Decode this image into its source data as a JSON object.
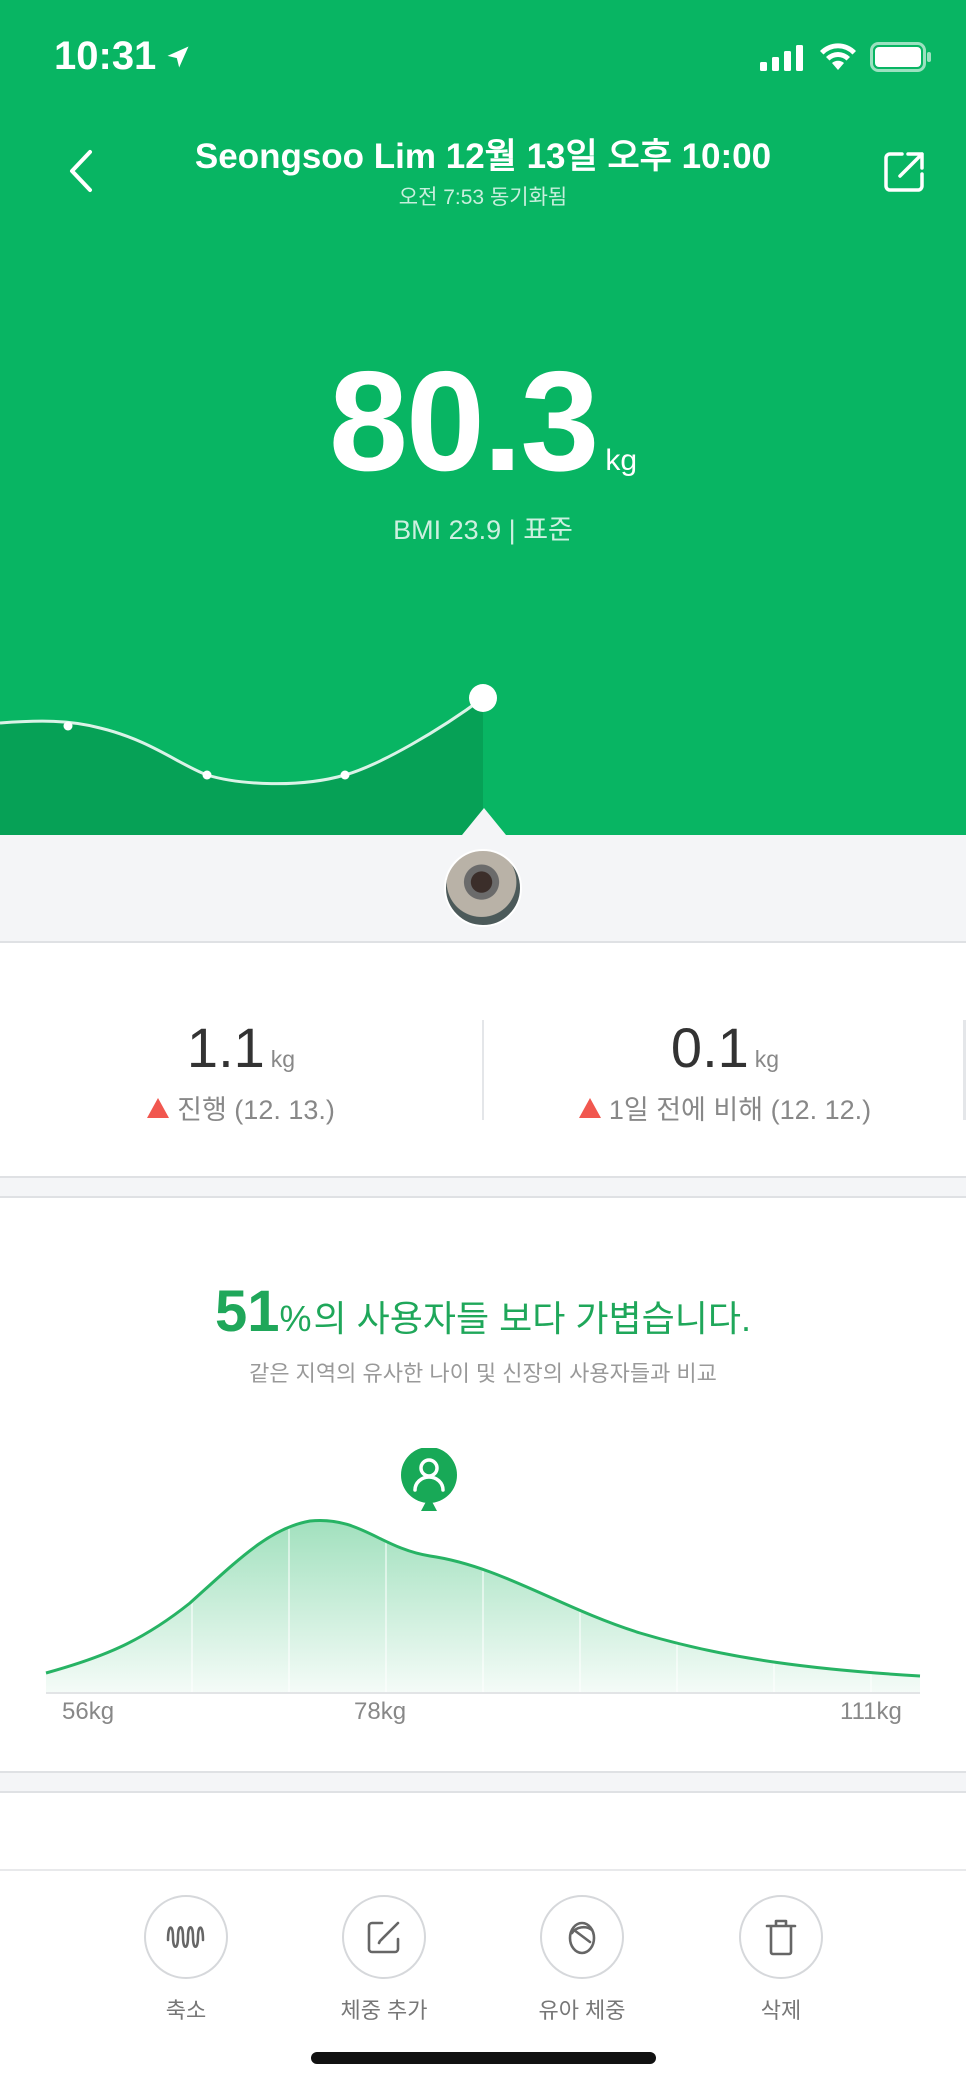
{
  "status_bar": {
    "time": "10:31"
  },
  "header": {
    "title": "Seongsoo Lim 12월 13일 오후 10:00",
    "subtitle": "오전 7:53 동기화됨"
  },
  "weight": {
    "value": "80.3",
    "unit": "kg",
    "bmi_line": "BMI 23.9 | 표준"
  },
  "stats": [
    {
      "value": "1.1",
      "unit": "kg",
      "label": "진행 (12. 13.)"
    },
    {
      "value": "0.1",
      "unit": "kg",
      "label": "1일 전에 비해 (12. 12.)"
    }
  ],
  "comparison": {
    "percent": "51",
    "percent_sign": "%",
    "headline_rest": "의 사용자들 보다 가볍습니다.",
    "subtext": "같은 지역의 유사한 나이 및 신장의 사용자들과 비교",
    "axis_labels": [
      "56kg",
      "78kg",
      "111kg"
    ]
  },
  "toolbar": [
    {
      "label": "축소",
      "icon": "collapse-wave-icon"
    },
    {
      "label": "체중 추가",
      "icon": "edit-square-icon"
    },
    {
      "label": "유아 체중",
      "icon": "infant-icon"
    },
    {
      "label": "삭제",
      "icon": "trash-icon"
    }
  ],
  "colors": {
    "brand_green": "#08b563",
    "accent_green": "#1fa75a",
    "increase_red": "#f1574f"
  }
}
